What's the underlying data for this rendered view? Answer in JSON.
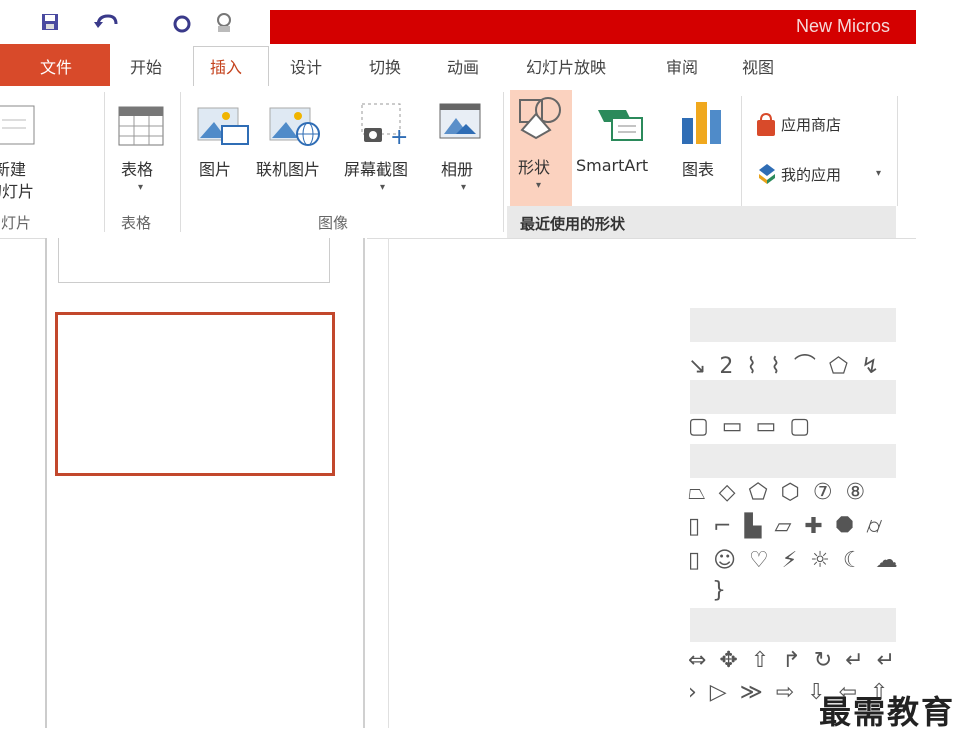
{
  "window": {
    "title": "New Micros"
  },
  "tabs": [
    {
      "label": "文件"
    },
    {
      "label": "开始"
    },
    {
      "label": "插入"
    },
    {
      "label": "设计"
    },
    {
      "label": "切换"
    },
    {
      "label": "动画"
    },
    {
      "label": "幻灯片放映"
    },
    {
      "label": "审阅"
    },
    {
      "label": "视图"
    }
  ],
  "ribbon": {
    "new_slide_line1": "新建",
    "new_slide_line2": "幻灯片",
    "table": "表格",
    "picture": "图片",
    "online_picture": "联机图片",
    "screenshot": "屏幕截图",
    "album": "相册",
    "shapes": "形状",
    "smartart": "SmartArt",
    "chart": "图表",
    "app_store": "应用商店",
    "my_apps": "我的应用",
    "groups": {
      "slides": "幻灯片",
      "tables": "表格",
      "images": "图像"
    }
  },
  "shapes_gallery": {
    "recent_header": "最近使用的形状",
    "rows": [
      "↘ 2 ⌇ ⌇ ⌒ ⬠ ↯",
      "▢ ▭ ▭ ▢",
      "⏢ ◇ ⬠ ⬡ ⑦ ⑧",
      "▯ ⌐ ▙ ▱ ✚ ⯃ ⌭",
      "▯ ☺ ♡ ⚡ ☼ ☾ ☁",
      "}",
      "⇔ ✥ ⇧ ↱ ↻ ↵ ↵",
      "› ▷ ≫ ⇨ ⇩ ⇦ ⇧"
    ]
  },
  "watermark": "最需教育",
  "colors": {
    "title_bar": "#d40000",
    "file_tab": "#d84a2a",
    "selected_thumb_border": "#c2472c",
    "active_button": "#fbd2bf"
  }
}
